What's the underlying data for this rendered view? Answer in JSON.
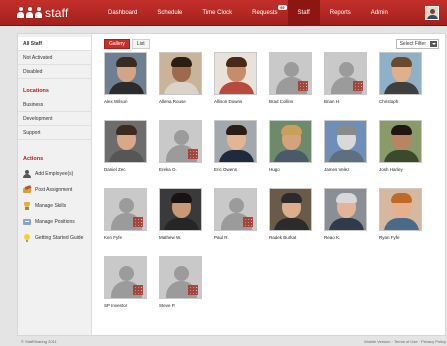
{
  "app": {
    "title": "staff",
    "brand_color": "#c4302b"
  },
  "nav": [
    {
      "label": "Dashboard",
      "active": false
    },
    {
      "label": "Schedule",
      "active": false
    },
    {
      "label": "Time Clock",
      "active": false
    },
    {
      "label": "Requests",
      "active": false,
      "badge": "99"
    },
    {
      "label": "Staff",
      "active": true
    },
    {
      "label": "Reports",
      "active": false
    },
    {
      "label": "Admin",
      "active": false
    }
  ],
  "sidebar": {
    "groups": [
      {
        "label": "All Staff",
        "selected": true
      },
      {
        "label": "Not Activated",
        "selected": false
      },
      {
        "label": "Disabled",
        "selected": false
      }
    ],
    "locations_heading": "Locations",
    "locations": [
      {
        "label": "Business"
      },
      {
        "label": "Development"
      },
      {
        "label": "Support"
      }
    ],
    "actions_heading": "Actions",
    "actions": [
      {
        "label": "Add Employee(s)",
        "icon": "add-user-icon"
      },
      {
        "label": "Post Assignment",
        "icon": "post-icon"
      },
      {
        "label": "Manage Skills",
        "icon": "skills-icon"
      },
      {
        "label": "Manage Positions",
        "icon": "positions-icon"
      },
      {
        "label": "Getting Started Guide",
        "icon": "lightbulb-icon"
      }
    ]
  },
  "view": {
    "gallery_label": "Gallery",
    "list_label": "List",
    "active": "gallery"
  },
  "filter": {
    "label": "Select Filter"
  },
  "staff": [
    {
      "name": "Alex Wilson",
      "photo": "real"
    },
    {
      "name": "Allena Rouse",
      "photo": "real"
    },
    {
      "name": "Allison Downs",
      "photo": "real"
    },
    {
      "name": "Brad Collins",
      "photo": "placeholder"
    },
    {
      "name": "Brian H.",
      "photo": "placeholder"
    },
    {
      "name": "Christoph",
      "photo": "real"
    },
    {
      "name": "Daniel Zec",
      "photo": "real"
    },
    {
      "name": "Ereka O.",
      "photo": "placeholder"
    },
    {
      "name": "Eric Owens",
      "photo": "real"
    },
    {
      "name": "Hugo",
      "photo": "real"
    },
    {
      "name": "James Velez",
      "photo": "real"
    },
    {
      "name": "Josh Harley",
      "photo": "real"
    },
    {
      "name": "Ken Fyfe",
      "photo": "placeholder"
    },
    {
      "name": "Mathew W.",
      "photo": "real"
    },
    {
      "name": "Paul R.",
      "photo": "placeholder"
    },
    {
      "name": "Radek Burkat",
      "photo": "real"
    },
    {
      "name": "Reao K.",
      "photo": "real"
    },
    {
      "name": "Ryan Fyfe",
      "photo": "real"
    },
    {
      "name": "SP Investor",
      "photo": "placeholder"
    },
    {
      "name": "Steve P.",
      "photo": "placeholder"
    }
  ],
  "footer": {
    "copyright": "© StaffSharing 2011",
    "links": "Mobile Version  ·  Terms of Use  ·  Privacy Policy"
  }
}
